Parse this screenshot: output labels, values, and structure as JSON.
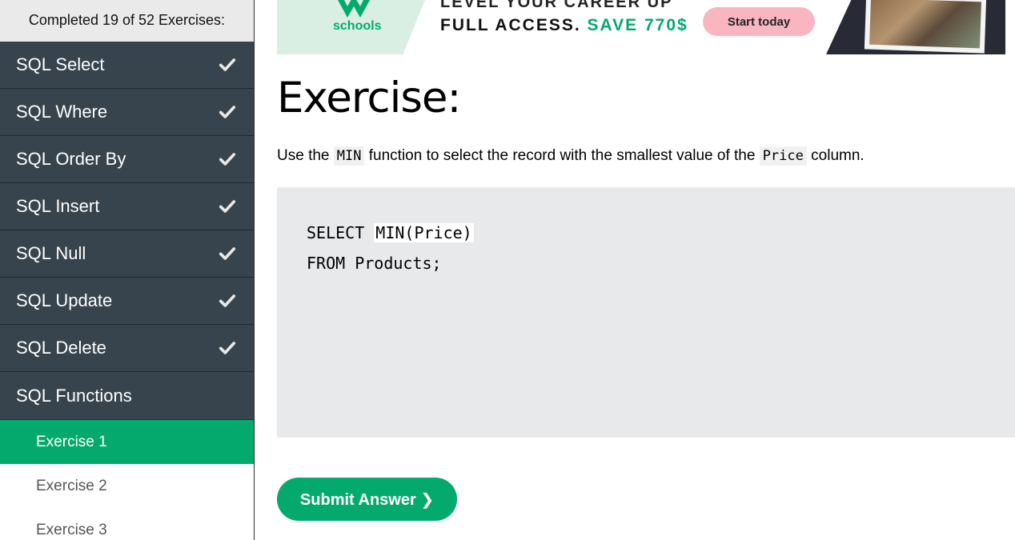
{
  "sidebar": {
    "progress_text": "Completed 19 of 52 Exercises:",
    "topics": [
      {
        "label": "SQL Select",
        "completed": true
      },
      {
        "label": "SQL Where",
        "completed": true
      },
      {
        "label": "SQL Order By",
        "completed": true
      },
      {
        "label": "SQL Insert",
        "completed": true
      },
      {
        "label": "SQL Null",
        "completed": true
      },
      {
        "label": "SQL Update",
        "completed": true
      },
      {
        "label": "SQL Delete",
        "completed": true
      },
      {
        "label": "SQL Functions",
        "completed": false
      }
    ],
    "exercises": [
      {
        "label": "Exercise 1",
        "active": true
      },
      {
        "label": "Exercise 2",
        "active": false
      },
      {
        "label": "Exercise 3",
        "active": false
      }
    ]
  },
  "banner": {
    "brand": "schools",
    "partial_text": "LEVEL YOUR CAREER UP",
    "headline_prefix": "FULL ACCESS.",
    "headline_save": "SAVE 770$",
    "cta_label": "Start today"
  },
  "main": {
    "title": "Exercise:",
    "instruction": {
      "part1": "Use the ",
      "code1": "MIN",
      "part2": " function to select the record with the smallest value of the ",
      "code2": "Price",
      "part3": " column."
    },
    "code": {
      "line1_prefix": "SELECT ",
      "line1_input": "MIN(Price)",
      "line2": "FROM Products;"
    },
    "submit_label": "Submit Answer ❯"
  },
  "colors": {
    "accent": "#04aa6d",
    "sidebar_dark": "#38444d",
    "code_bg": "#e7e9eb",
    "banner_cta": "#f9b6c1"
  }
}
